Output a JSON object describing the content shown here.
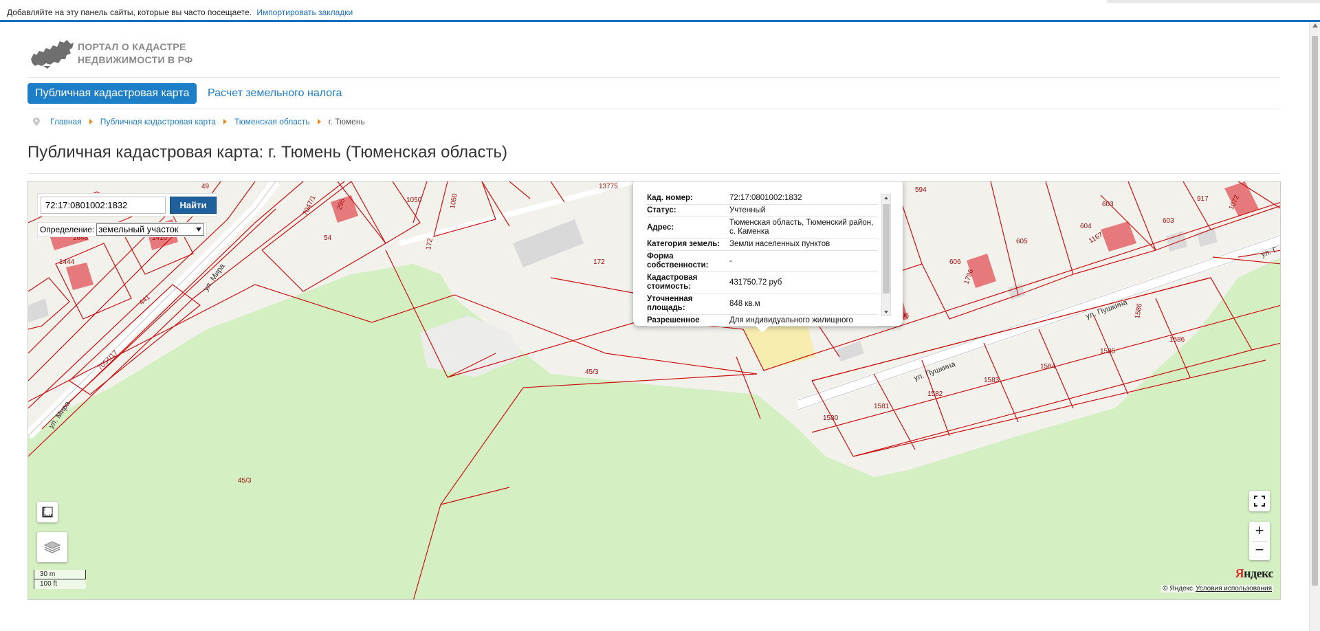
{
  "bookmarks_bar": {
    "text": "Добавляйте на эту панель сайты, которые вы часто посещаете.",
    "link": "Импортировать закладки"
  },
  "header": {
    "logo_line1": "ПОРТАЛ О КАДАСТРЕ",
    "logo_line2": "НЕДВИЖИМОСТИ В РФ"
  },
  "nav": {
    "active": "Публичная кадастровая карта",
    "link": "Расчет земельного налога"
  },
  "breadcrumb": {
    "items": [
      "Главная",
      "Публичная кадастровая карта",
      "Тюменская область"
    ],
    "current": "г. Тюмень"
  },
  "page_title": "Публичная кадастровая карта: г. Тюмень (Тюменская область)",
  "map": {
    "search": {
      "value": "72:17:0801002:1832",
      "button": "Найти"
    },
    "definition": {
      "label": "Определение:",
      "selected": "земельный участок"
    },
    "popup": {
      "rows": [
        {
          "key": "Кад. номер:",
          "value": "72:17:0801002:1832"
        },
        {
          "key": "Статус:",
          "value": "Учтенный"
        },
        {
          "key": "Адрес:",
          "value": "Тюменская область, Тюменский район, с. Каменка"
        },
        {
          "key": "Категория земель:",
          "value": "Земли населенных пунктов"
        },
        {
          "key": "Форма собственности:",
          "value": "-"
        },
        {
          "key": "Кадастровая стоимость:",
          "value": "431750.72 руб"
        },
        {
          "key": "Уточненная площадь:",
          "value": "848 кв.м"
        },
        {
          "key": "Разрешенное",
          "value": "Для индивидуального жилищного"
        }
      ]
    },
    "labels": {
      "streets": [
        "ул. Мира",
        "ул. Мира",
        "ул. Пушкина",
        "ул. Пушкина",
        "ул. Г"
      ],
      "parcels": [
        "1050",
        "1050",
        "54",
        "172",
        "172",
        "45/3",
        "45/3",
        "441",
        "7054/17",
        "7047/1",
        "1444",
        "1648",
        "1410",
        "295",
        "49",
        "594",
        "603",
        "603",
        "604",
        "605",
        "606",
        "917",
        "1072",
        "1167",
        "1796",
        "96",
        "1580",
        "1581",
        "1582",
        "1583",
        "1584",
        "1585",
        "1586",
        "1586",
        "13775"
      ]
    },
    "scale": {
      "metric": "30 m",
      "imperial": "100 ft"
    },
    "zoom": {
      "in": "+",
      "out": "−"
    },
    "brand": {
      "part1": "Я",
      "part2": "ндекс"
    },
    "copyright": {
      "owner": "© Яндекс",
      "terms": "Условия использования"
    }
  },
  "colors": {
    "accent": "#1e7ec8",
    "search_button": "#1f5f9b",
    "parcel_border": "#cc1111",
    "forest": "#d4efc2",
    "building": "#e5797b",
    "selected_parcel": "#f6eca8",
    "crumb_arrow": "#e88a1a"
  }
}
